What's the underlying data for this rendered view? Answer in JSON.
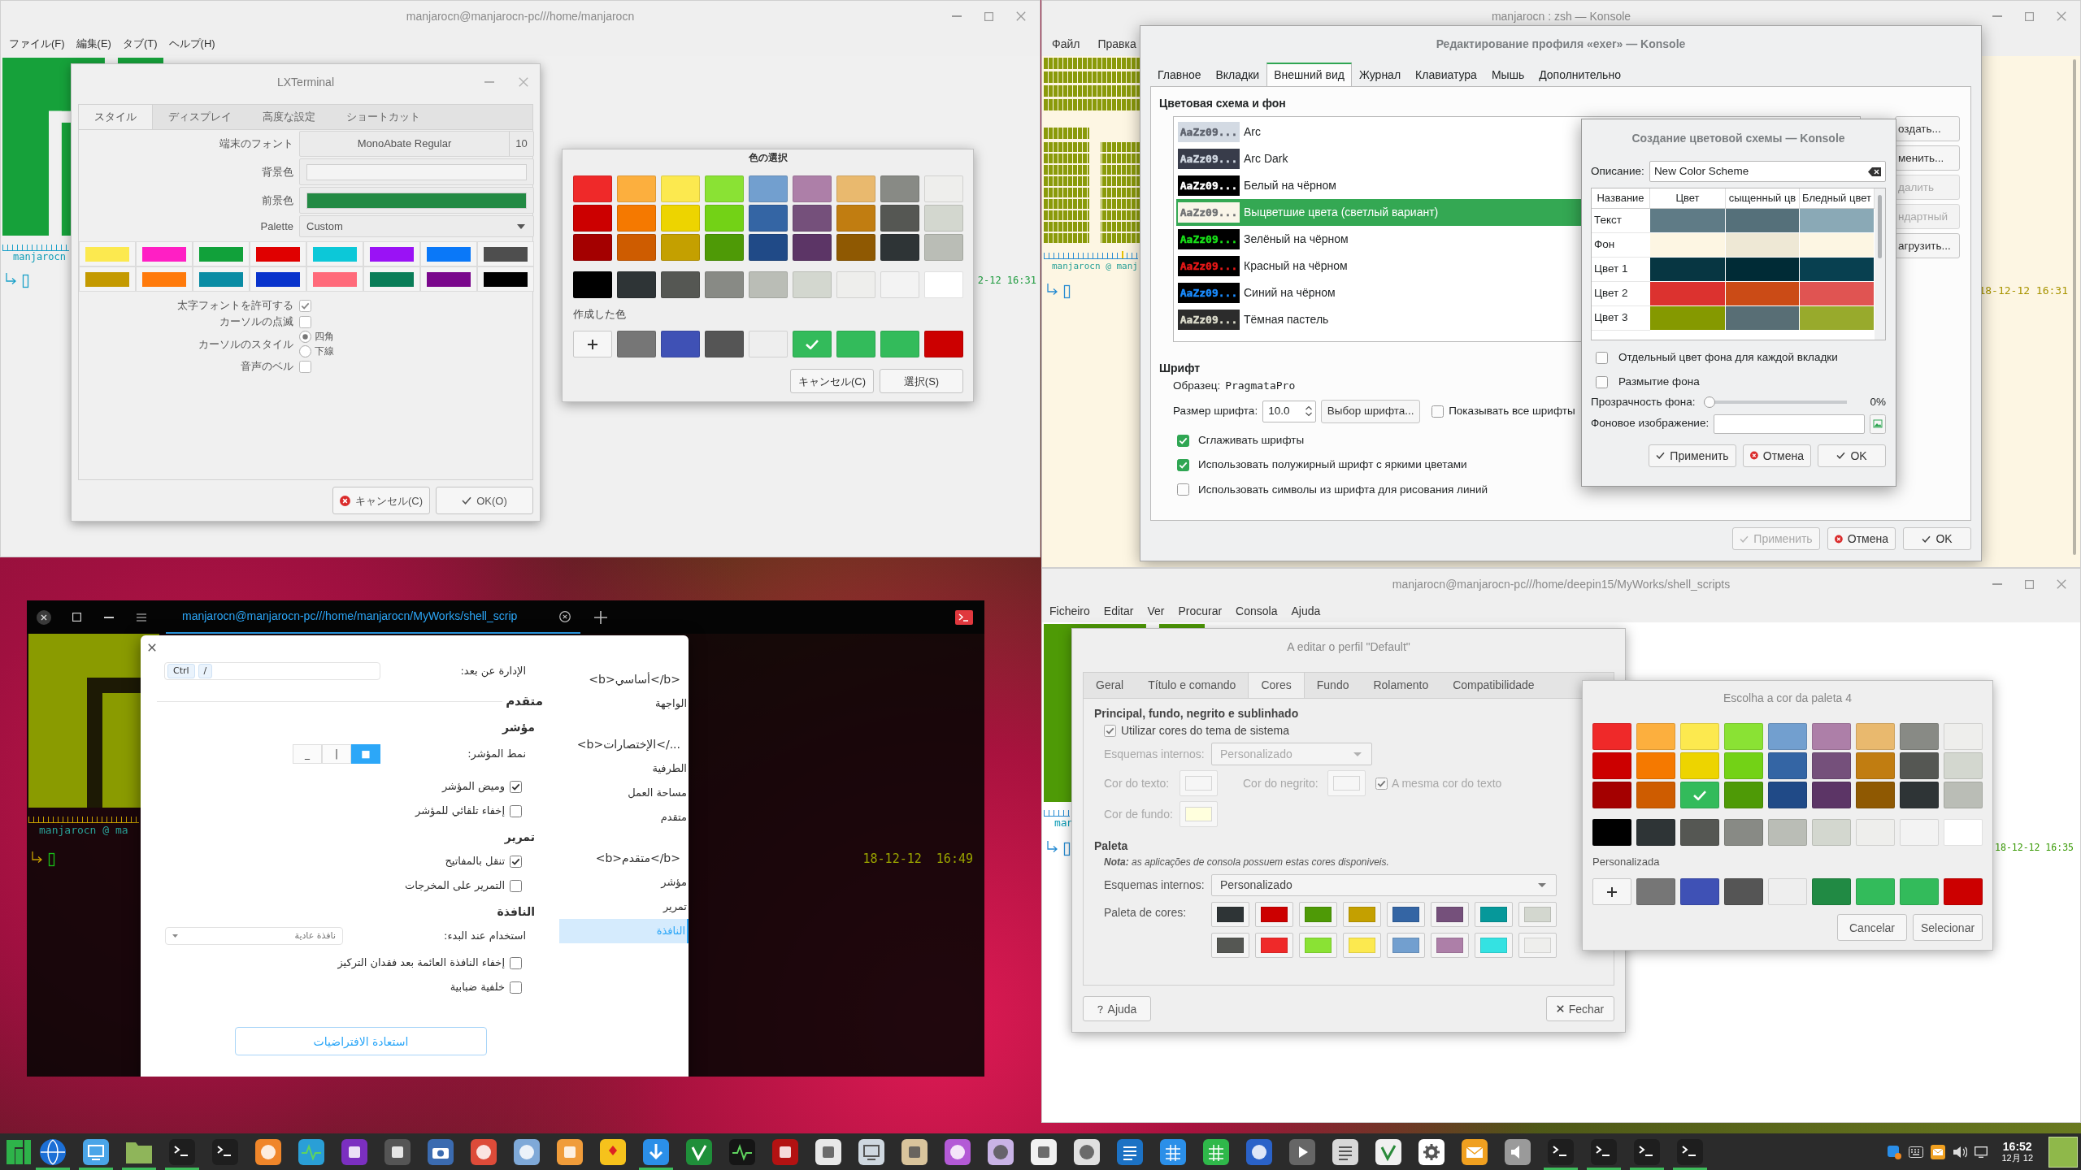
{
  "window_top_left": {
    "title": "manjarocn@manjarocn-pc///home/manjarocn",
    "menu": [
      "ファイル(F)",
      "編集(E)",
      "タブ(T)",
      "ヘルプ(H)"
    ],
    "terminal": {
      "prompt": "manjarocn",
      "clock": "2-12 16:31"
    },
    "preferences_dialog": {
      "title": "LXTerminal",
      "tabs": [
        {
          "label": "スタイル",
          "selected": true
        },
        {
          "label": "ディスプレイ",
          "selected": false
        },
        {
          "label": "高度な設定",
          "selected": false
        },
        {
          "label": "ショートカット",
          "selected": false
        }
      ],
      "font": {
        "label": "端末のフォント",
        "value": "MonoAbate Regular",
        "size": "10"
      },
      "background": {
        "label": "背景色",
        "color": "#f4f4f4"
      },
      "foreground": {
        "label": "前景色",
        "color": "#238a44"
      },
      "palette": {
        "label": "Palette",
        "value": "Custom",
        "colors": [
          {
            "color": "#fce94f"
          },
          {
            "color": "#ff1fc4"
          },
          {
            "color": "#11a13a"
          },
          {
            "color": "#e00000"
          },
          {
            "color": "#0cc8d8"
          },
          {
            "color": "#9a12f5"
          },
          {
            "color": "#0a78f8"
          },
          {
            "color": "#4e4e4e"
          },
          {
            "color": "#c49a00"
          },
          {
            "color": "#ff7a0b"
          },
          {
            "color": "#0a8ca4"
          },
          {
            "color": "#0833cc"
          },
          {
            "color": "#ff6a7a"
          },
          {
            "color": "#0a7d58"
          },
          {
            "color": "#7a078c"
          },
          {
            "color": "#000000"
          }
        ]
      },
      "options": [
        {
          "kind": "checkbox",
          "label": "太字フォントを許可する",
          "checked": true
        },
        {
          "kind": "checkbox",
          "label": "カーソルの点滅",
          "checked": false
        },
        {
          "kind": "radio",
          "label": "カーソルのスタイル",
          "choices": [
            {
              "label": "四角",
              "selected": true
            },
            {
              "label": "下線",
              "selected": false
            }
          ]
        },
        {
          "kind": "checkbox",
          "label": "音声のベル",
          "checked": false
        }
      ],
      "buttons": [
        {
          "label": "キャンセル(C)",
          "kind": "cancel"
        },
        {
          "label": "OK(O)",
          "kind": "ok"
        }
      ]
    },
    "color_dialog": {
      "title": "色の選択",
      "palette": [
        [
          {
            "color": "#ef2929",
            "selected": false
          },
          {
            "color": "#fcaf3e",
            "selected": false
          },
          {
            "color": "#fce94f",
            "selected": false
          },
          {
            "color": "#8ae234",
            "selected": false
          },
          {
            "color": "#729fcf",
            "selected": false
          },
          {
            "color": "#ad7fa8",
            "selected": false
          },
          {
            "color": "#e9b96e",
            "selected": false
          },
          {
            "color": "#888a85",
            "selected": false
          },
          {
            "color": "#eeeeec",
            "selected": false
          }
        ],
        [
          {
            "color": "#cc0000",
            "selected": false
          },
          {
            "color": "#f57900",
            "selected": false
          },
          {
            "color": "#edd400",
            "selected": false
          },
          {
            "color": "#73d216",
            "selected": false
          },
          {
            "color": "#3465a4",
            "selected": false
          },
          {
            "color": "#75507b",
            "selected": false
          },
          {
            "color": "#c17d11",
            "selected": false
          },
          {
            "color": "#555753",
            "selected": false
          },
          {
            "color": "#d3d7cf",
            "selected": false
          }
        ],
        [
          {
            "color": "#a40000",
            "selected": false
          },
          {
            "color": "#ce5c00",
            "selected": false
          },
          {
            "color": "#c4a000",
            "selected": false
          },
          {
            "color": "#4e9a06",
            "selected": false
          },
          {
            "color": "#204a87",
            "selected": false
          },
          {
            "color": "#5c3566",
            "selected": false
          },
          {
            "color": "#8f5902",
            "selected": false
          },
          {
            "color": "#2e3436",
            "selected": false
          },
          {
            "color": "#babdb6",
            "selected": false
          }
        ]
      ],
      "grays": [
        {
          "color": "#000000",
          "selected": false
        },
        {
          "color": "#2e3436",
          "selected": false
        },
        {
          "color": "#555753",
          "selected": false
        },
        {
          "color": "#888a85",
          "selected": false
        },
        {
          "color": "#babdb6",
          "selected": false
        },
        {
          "color": "#d3d7cf",
          "selected": false
        },
        {
          "color": "#eeeeec",
          "selected": false
        },
        {
          "color": "#f3f3f3",
          "selected": false
        },
        {
          "color": "#ffffff",
          "selected": false
        }
      ],
      "custom_label": "作成した色",
      "custom": [
        {
          "color": "#767676",
          "selected": false
        },
        {
          "color": "#3f51b5",
          "selected": false
        },
        {
          "color": "#555555",
          "selected": false
        },
        {
          "color": "#eeeeee",
          "selected": false
        },
        {
          "color": "#33bb5b",
          "selected": true
        },
        {
          "color": "#33bb5b",
          "selected": false
        },
        {
          "color": "#33bb5b",
          "selected": false
        },
        {
          "color": "#cc0000",
          "selected": false
        }
      ],
      "buttons": [
        "キャンセル(C)",
        "選択(S)"
      ]
    }
  },
  "window_top_right": {
    "title": "manjarocn : zsh — Konsole",
    "menu": [
      "Файл",
      "Правка"
    ],
    "terminal": {
      "prompt": "manjarocn @ manj",
      "clock": "18-12-12 16:31"
    },
    "profile_dialog": {
      "title": "Редактирование профиля «exer» — Konsole",
      "tabs": [
        {
          "label": "Главное",
          "selected": false
        },
        {
          "label": "Вкладки",
          "selected": false
        },
        {
          "label": "Внешний вид",
          "selected": true
        },
        {
          "label": "Журнал",
          "selected": false
        },
        {
          "label": "Клавиатура",
          "selected": false
        },
        {
          "label": "Мышь",
          "selected": false
        },
        {
          "label": "Дополнительно",
          "selected": false
        }
      ],
      "scheme_section": "Цветовая схема и фон",
      "schemes": [
        {
          "preview": "AaZz09...",
          "name": "Arc",
          "background": {
            "color": "#d3dae3"
          },
          "foreground": {
            "color": "#5c616c"
          },
          "selected": false
        },
        {
          "preview": "AaZz09...",
          "name": "Arc Dark",
          "background": {
            "color": "#383c4a"
          },
          "foreground": {
            "color": "#d3dae3"
          },
          "selected": false
        },
        {
          "preview": "AaZz09...",
          "name": "Белый на чёрном",
          "background": {
            "color": "#000000"
          },
          "foreground": {
            "color": "#ffffff"
          },
          "selected": false
        },
        {
          "preview": "AaZz09...",
          "name": "Выцветшие цвета (светлый вариант)",
          "background": {
            "color": "#f9f5e9"
          },
          "foreground": {
            "color": "#6f7173"
          },
          "selected": true
        },
        {
          "preview": "AaZz09...",
          "name": "Зелёный на чёрном",
          "background": {
            "color": "#000000"
          },
          "foreground": {
            "color": "#18e018"
          },
          "selected": false
        },
        {
          "preview": "AaZz09...",
          "name": "Красный на чёрном",
          "background": {
            "color": "#000000"
          },
          "foreground": {
            "color": "#e81818"
          },
          "selected": false
        },
        {
          "preview": "AaZz09...",
          "name": "Синий на чёрном",
          "background": {
            "color": "#000000"
          },
          "foreground": {
            "color": "#1a8cff"
          },
          "selected": false
        },
        {
          "preview": "AaZz09...",
          "name": "Тёмная пастель",
          "background": {
            "color": "#2c2c2c"
          },
          "foreground": {
            "color": "#dcdccc"
          },
          "selected": false
        }
      ],
      "scheme_buttons": [
        {
          "label": "оздать...",
          "disabled": false
        },
        {
          "label": "менить...",
          "disabled": false
        },
        {
          "label": "далить",
          "disabled": true
        },
        {
          "label": "ндартный",
          "disabled": true
        },
        {
          "label": "агрузить...",
          "disabled": false
        }
      ],
      "font_section": "Шрифт",
      "sample": {
        "label": "Образец:",
        "value": "PragmataPro"
      },
      "size": {
        "label": "Размер шрифта:",
        "value": "10.0"
      },
      "choose_font": "Выбор шрифта...",
      "show_all": {
        "label": "Показывать все шрифты",
        "checked": false
      },
      "options": [
        {
          "label": "Сглаживать шрифты",
          "checked": true
        },
        {
          "label": "Использовать полужирный шрифт с яркими цветами",
          "checked": true
        },
        {
          "label": "Использовать символы из шрифта для рисования линий",
          "checked": false
        }
      ],
      "buttons": [
        {
          "label": "Применить",
          "kind": "apply",
          "disabled": true
        },
        {
          "label": "Отмена",
          "kind": "cancel",
          "disabled": false
        },
        {
          "label": "OK",
          "kind": "ok",
          "disabled": false
        }
      ]
    },
    "scheme_dialog": {
      "title": "Создание цветовой схемы — Konsole",
      "description": {
        "label": "Описание:",
        "value": "New Color Scheme"
      },
      "columns": [
        "Название",
        "Цвет",
        "сыщенный цв",
        "Бледный цвет"
      ],
      "rows": [
        {
          "name": "Текст",
          "colors": [
            {
              "color": "#5f7b86"
            },
            {
              "color": "#55707a"
            },
            {
              "color": "#8aa9b6"
            }
          ]
        },
        {
          "name": "Фон",
          "colors": [
            {
              "color": "#fdf6e3"
            },
            {
              "color": "#eee8d5"
            },
            {
              "color": "#fdf6e3"
            }
          ]
        },
        {
          "name": "Цвет 1",
          "colors": [
            {
              "color": "#073642"
            },
            {
              "color": "#002b36"
            },
            {
              "color": "#084050"
            }
          ]
        },
        {
          "name": "Цвет 2",
          "colors": [
            {
              "color": "#dc322f"
            },
            {
              "color": "#cb4b16"
            },
            {
              "color": "#e05452"
            }
          ]
        },
        {
          "name": "Цвет 3",
          "colors": [
            {
              "color": "#859900"
            },
            {
              "color": "#586e75"
            },
            {
              "color": "#98aa2c"
            }
          ]
        }
      ],
      "options": [
        {
          "label": "Отдельный цвет фона для каждой вкладки",
          "checked": false
        },
        {
          "label": "Размытие фона",
          "checked": false
        }
      ],
      "transparency": {
        "label": "Прозрачность фона:",
        "level": 0,
        "reading": "0%"
      },
      "image": {
        "label": "Фоновое изображение:"
      },
      "buttons": [
        {
          "label": "Применить",
          "kind": "apply"
        },
        {
          "label": "Отмена",
          "kind": "cancel"
        },
        {
          "label": "OK",
          "kind": "ok"
        }
      ]
    }
  },
  "window_bottom_left": {
    "tabs": [
      {
        "title": "manjarocn@manjarocn-pc///home/manjarocn/MyWorks/shell_scrip",
        "selected": true
      }
    ],
    "terminal": {
      "prompt": "manjarocn @ ma",
      "clock": "18-12-12  16:49"
    },
    "settings_dialog": {
      "nav": [
        {
          "kind": "heading",
          "label": "<b>أساسي</b>",
          "selected": false
        },
        {
          "kind": "item",
          "label": "الواجهة",
          "selected": false
        },
        {
          "kind": "heading",
          "label": "<b>الإختصارات</...",
          "selected": false
        },
        {
          "kind": "item",
          "label": "الطرفية",
          "selected": false
        },
        {
          "kind": "item",
          "label": "مساحة العمل",
          "selected": false
        },
        {
          "kind": "item",
          "label": "متقدم",
          "selected": false
        },
        {
          "kind": "heading",
          "label": "<b>متقدم</b>",
          "selected": false
        },
        {
          "kind": "item",
          "label": "مؤشر",
          "selected": false
        },
        {
          "kind": "item",
          "label": "تمرير",
          "selected": false
        },
        {
          "kind": "item",
          "label": "النافذة",
          "selected": true
        }
      ],
      "remote": {
        "label": "الإدارة عن بعد:",
        "keys": [
          "Ctrl",
          "/"
        ]
      },
      "sections": [
        {
          "kind": "heading",
          "label": "متقدم"
        },
        {
          "kind": "subheading",
          "label": "مؤشر"
        },
        {
          "kind": "segments",
          "label": "نمط المؤشر:",
          "options": [
            {
              "label": "_",
              "selected": false
            },
            {
              "label": "|",
              "selected": false
            },
            {
              "label": "■",
              "selected": true
            }
          ]
        },
        {
          "kind": "checkbox",
          "label": "وميض المؤشر",
          "checked": true
        },
        {
          "kind": "checkbox",
          "label": "إخفاء تلقائي للمؤشر",
          "checked": false
        },
        {
          "kind": "subheading",
          "label": "تمرير"
        },
        {
          "kind": "checkbox",
          "label": "تنقل بالمفاتيح",
          "checked": true
        },
        {
          "kind": "checkbox",
          "label": "التمرير على المخرجات",
          "checked": false
        },
        {
          "kind": "subheading",
          "label": "النافذة"
        },
        {
          "kind": "dropdown",
          "label": "استخدام عند البدء:",
          "value": "نافذة عادية"
        },
        {
          "kind": "checkbox",
          "label": "إخفاء النافذة العائمة بعد فقدان التركيز",
          "checked": false
        },
        {
          "kind": "checkbox",
          "label": "خلفية ضبابية",
          "checked": false
        }
      ],
      "reset_button": "استعادة الافتراضيات"
    }
  },
  "window_bottom_right": {
    "title": "manjarocn@manjarocn-pc///home/deepin15/MyWorks/shell_scripts",
    "menu": [
      "Ficheiro",
      "Editar",
      "Ver",
      "Procurar",
      "Consola",
      "Ajuda"
    ],
    "terminal": {
      "prompt": "man",
      "clock": "18-12-12 16:35"
    },
    "profile_dialog": {
      "title": "A editar o perfil \"Default\"",
      "tabs": [
        {
          "label": "Geral",
          "selected": false
        },
        {
          "label": "Título e comando",
          "selected": false
        },
        {
          "label": "Cores",
          "selected": true
        },
        {
          "label": "Fundo",
          "selected": false
        },
        {
          "label": "Rolamento",
          "selected": false
        },
        {
          "label": "Compatibilidade",
          "selected": false
        }
      ],
      "section_title": "Principal, fundo, negrito e sublinhado",
      "use_theme_colors": {
        "label": "Utilizar cores do tema de sistema",
        "checked": true
      },
      "builtin_schemes": {
        "label": "Esquemas internos:",
        "value": "Personalizado",
        "disabled": true
      },
      "text_color": {
        "label": "Cor do texto:",
        "color": "#f6f6f6",
        "disabled": true
      },
      "bold_color": {
        "label": "Cor do negrito:",
        "color": "#f6f6f6",
        "disabled": true
      },
      "same_as_text": {
        "label": "A mesma cor do texto",
        "checked": true,
        "disabled": true
      },
      "background_color": {
        "label": "Cor de fundo:",
        "color": "#ffffdd",
        "disabled": true
      },
      "palette_title": "Paleta",
      "note": "**Nota:** as aplicações de consola possuem estas cores disponiveis.",
      "palette_schemes": {
        "label": "Esquemas internos:",
        "value": "Personalizado"
      },
      "palette": {
        "label": "Paleta de cores:",
        "colors": [
          {
            "color": "#2e3436"
          },
          {
            "color": "#cc0000"
          },
          {
            "color": "#4e9a06"
          },
          {
            "color": "#c4a000"
          },
          {
            "color": "#3465a4"
          },
          {
            "color": "#75507b"
          },
          {
            "color": "#06989a"
          },
          {
            "color": "#d3d7cf"
          },
          {
            "color": "#555753"
          },
          {
            "color": "#ef2929"
          },
          {
            "color": "#8ae234"
          },
          {
            "color": "#fce94f"
          },
          {
            "color": "#729fcf"
          },
          {
            "color": "#ad7fa8"
          },
          {
            "color": "#34e2e2"
          },
          {
            "color": "#eeeeec"
          }
        ]
      },
      "buttons": [
        {
          "label": "Ajuda",
          "kind": "help"
        },
        {
          "label": "Fechar",
          "kind": "close"
        }
      ]
    },
    "color_dialog": {
      "title": "Escolha a cor da paleta 4",
      "palette": [
        [
          {
            "color": "#ef2929",
            "selected": false
          },
          {
            "color": "#fcaf3e",
            "selected": false
          },
          {
            "color": "#fce94f",
            "selected": false
          },
          {
            "color": "#8ae234",
            "selected": false
          },
          {
            "color": "#729fcf",
            "selected": false
          },
          {
            "color": "#ad7fa8",
            "selected": false
          },
          {
            "color": "#e9b96e",
            "selected": false
          },
          {
            "color": "#888a85",
            "selected": false
          },
          {
            "color": "#eeeeec",
            "selected": false
          }
        ],
        [
          {
            "color": "#cc0000",
            "selected": false
          },
          {
            "color": "#f57900",
            "selected": false
          },
          {
            "color": "#edd400",
            "selected": false
          },
          {
            "color": "#73d216",
            "selected": false
          },
          {
            "color": "#3465a4",
            "selected": false
          },
          {
            "color": "#75507b",
            "selected": false
          },
          {
            "color": "#c17d11",
            "selected": false
          },
          {
            "color": "#555753",
            "selected": false
          },
          {
            "color": "#d3d7cf",
            "selected": false
          }
        ],
        [
          {
            "color": "#a40000",
            "selected": false
          },
          {
            "color": "#ce5c00",
            "selected": false
          },
          {
            "color": "#33bb5b",
            "selected": true
          },
          {
            "color": "#4e9a06",
            "selected": false
          },
          {
            "color": "#204a87",
            "selected": false
          },
          {
            "color": "#5c3566",
            "selected": false
          },
          {
            "color": "#8f5902",
            "selected": false
          },
          {
            "color": "#2e3436",
            "selected": false
          },
          {
            "color": "#babdb6",
            "selected": false
          }
        ]
      ],
      "grays": [
        {
          "color": "#000000",
          "selected": false
        },
        {
          "color": "#2e3436",
          "selected": false
        },
        {
          "color": "#555753",
          "selected": false
        },
        {
          "color": "#888a85",
          "selected": false
        },
        {
          "color": "#babdb6",
          "selected": false
        },
        {
          "color": "#d3d7cf",
          "selected": false
        },
        {
          "color": "#eeeeec",
          "selected": false
        },
        {
          "color": "#f3f3f3",
          "selected": false
        },
        {
          "color": "#ffffff",
          "selected": false
        }
      ],
      "custom_label": "Personalizada",
      "custom": [
        {
          "color": "#767676",
          "selected": false
        },
        {
          "color": "#3f51b5",
          "selected": false
        },
        {
          "color": "#555555",
          "selected": false
        },
        {
          "color": "#eeeeee",
          "selected": false
        },
        {
          "color": "#218a44",
          "selected": false
        },
        {
          "color": "#33bb5b",
          "selected": false
        },
        {
          "color": "#33bb5b",
          "selected": false
        },
        {
          "color": "#cc0000",
          "selected": false
        }
      ],
      "buttons": [
        "Cancelar",
        "Selecionar"
      ]
    }
  },
  "taskbar": {
    "apps": [
      {
        "kind": "logo",
        "color": "#2eb34a",
        "running": false
      },
      {
        "kind": "globe",
        "color": "#1c6fd6",
        "running": true
      },
      {
        "kind": "screen",
        "color": "#4aa5e8",
        "running": true
      },
      {
        "kind": "folder",
        "color": "#8fb55a",
        "running": true
      },
      {
        "kind": "terminal",
        "color": "#1e1e1e",
        "running": true
      },
      {
        "kind": "terminal",
        "color": "#1e1e1e",
        "running": false
      },
      {
        "kind": "circle",
        "color": "#f0862a",
        "running": false
      },
      {
        "kind": "pulse",
        "color": "#2a9fd6",
        "running": false
      },
      {
        "kind": "square",
        "color": "#7b2fc0",
        "running": false
      },
      {
        "kind": "square",
        "color": "#555555",
        "running": false
      },
      {
        "kind": "camera",
        "color": "#3b6bb0",
        "running": false
      },
      {
        "kind": "circle",
        "color": "#dd4b39",
        "running": false
      },
      {
        "kind": "circle",
        "color": "#7fa9d8",
        "running": false
      },
      {
        "kind": "square",
        "color": "#f09c3a",
        "running": false
      },
      {
        "kind": "diamond",
        "color": "#f6c21c",
        "running": false
      },
      {
        "kind": "arrow",
        "color": "#2b8fe8",
        "running": true
      },
      {
        "kind": "check",
        "color": "#1f8f3a",
        "running": false
      },
      {
        "kind": "pulse",
        "color": "#151515",
        "running": false
      },
      {
        "kind": "square",
        "color": "#b31212",
        "running": false
      },
      {
        "kind": "square",
        "color": "#e8e8e8",
        "running": false
      },
      {
        "kind": "screen",
        "color": "#cfd8e0",
        "running": false
      },
      {
        "kind": "square",
        "color": "#d9c49c",
        "running": false
      },
      {
        "kind": "circle",
        "color": "#b35ad6",
        "running": false
      },
      {
        "kind": "circle",
        "color": "#c9b3e6",
        "running": false
      },
      {
        "kind": "square",
        "color": "#f2f2f2",
        "running": false
      },
      {
        "kind": "circle",
        "color": "#e0e0e0",
        "running": false
      },
      {
        "kind": "lines",
        "color": "#1c72c4",
        "running": false
      },
      {
        "kind": "grid",
        "color": "#2b8fe8",
        "running": false
      },
      {
        "kind": "grid",
        "color": "#2fb84a",
        "running": false
      },
      {
        "kind": "circle",
        "color": "#2a62c8",
        "running": false
      },
      {
        "kind": "play",
        "color": "#666666",
        "running": false
      },
      {
        "kind": "lines",
        "color": "#d8d8d8",
        "running": false
      },
      {
        "kind": "check",
        "color": "#f0f0f0",
        "running": false
      },
      {
        "kind": "gear",
        "color": "#ffffff",
        "running": false
      },
      {
        "kind": "envelope",
        "color": "#f0a020",
        "running": false
      },
      {
        "kind": "speaker",
        "color": "#9a9a9a",
        "running": false
      },
      {
        "kind": "terminal",
        "color": "#1e1e1e",
        "running": true
      },
      {
        "kind": "terminal",
        "color": "#1e1e1e",
        "running": true
      },
      {
        "kind": "terminal",
        "color": "#1e1e1e",
        "running": true
      },
      {
        "kind": "terminal",
        "color": "#1e1e1e",
        "running": true
      }
    ],
    "tray": [
      {
        "kind": "input"
      },
      {
        "kind": "keyboard"
      },
      {
        "kind": "mail"
      },
      {
        "kind": "volume"
      },
      {
        "kind": "display"
      }
    ],
    "clock": {
      "time": "16:52",
      "date": "12月 12"
    }
  }
}
